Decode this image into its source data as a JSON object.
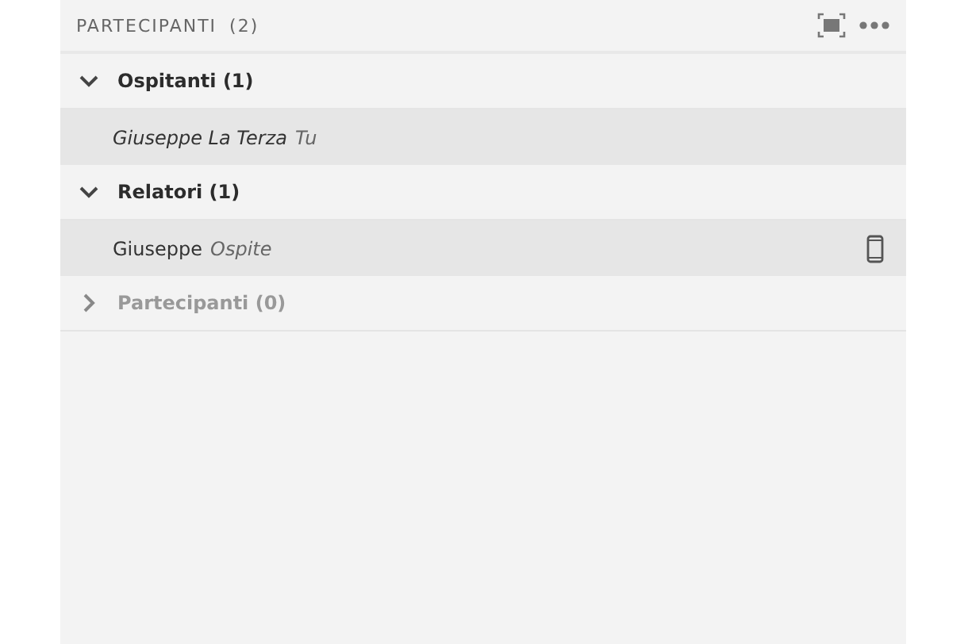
{
  "panel": {
    "title": "PARTECIPANTI",
    "count": "(2)"
  },
  "groups": [
    {
      "label": "Ospitanti (1)",
      "expanded": true,
      "disabled": false,
      "members": [
        {
          "name": "Giuseppe La Terza",
          "role": "Tu",
          "italic": true,
          "on_phone": false
        }
      ]
    },
    {
      "label": "Relatori (1)",
      "expanded": true,
      "disabled": false,
      "members": [
        {
          "name": "Giuseppe",
          "role": "Ospite",
          "italic": false,
          "on_phone": true
        }
      ]
    },
    {
      "label": "Partecipanti (0)",
      "expanded": false,
      "disabled": true
    }
  ]
}
